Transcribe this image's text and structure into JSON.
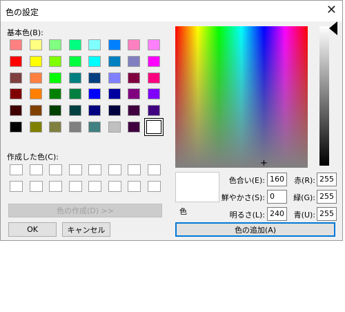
{
  "title": "色の設定",
  "close_glyph": "✕",
  "basic_colors_label": "基本色(B):",
  "basic_colors": [
    [
      "#ff8080",
      "#ffff80",
      "#80ff80",
      "#00ff80",
      "#80ffff",
      "#0080ff",
      "#ff80c0",
      "#ff80ff"
    ],
    [
      "#ff0000",
      "#ffff00",
      "#80ff00",
      "#00ff40",
      "#00ffff",
      "#0080c0",
      "#8080c0",
      "#ff00ff"
    ],
    [
      "#804040",
      "#ff8040",
      "#00ff00",
      "#008080",
      "#004080",
      "#8080ff",
      "#800040",
      "#ff0080"
    ],
    [
      "#800000",
      "#ff8000",
      "#008000",
      "#008040",
      "#0000ff",
      "#0000a0",
      "#800080",
      "#8000ff"
    ],
    [
      "#400000",
      "#804000",
      "#004000",
      "#004040",
      "#000080",
      "#000040",
      "#400040",
      "#400080"
    ],
    [
      "#000000",
      "#808000",
      "#808040",
      "#808080",
      "#408080",
      "#c0c0c0",
      "#400040",
      "#ffffff"
    ]
  ],
  "custom_colors_label": "作成した色(C):",
  "define_custom_button": "色の作成(D) >>",
  "ok_button": "OK",
  "cancel_button": "キャンセル",
  "color_solid_label": "色",
  "fields": {
    "hue": {
      "label": "色合い(E):",
      "value": "160"
    },
    "sat": {
      "label": "鮮やかさ(S):",
      "value": "0"
    },
    "lum": {
      "label": "明るさ(L):",
      "value": "240"
    },
    "red": {
      "label": "赤(R):",
      "value": "255"
    },
    "green": {
      "label": "緑(G):",
      "value": "255"
    },
    "blue": {
      "label": "青(U):",
      "value": "255"
    }
  },
  "add_custom_button": "色の追加(A)",
  "selected_basic_color": "#ffffff"
}
